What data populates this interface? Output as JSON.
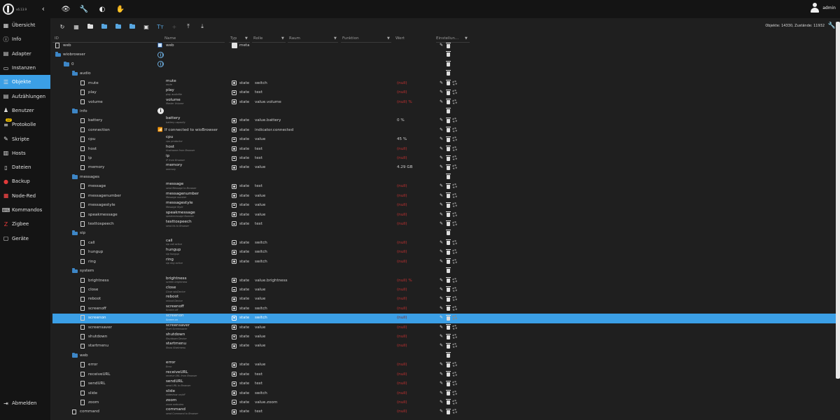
{
  "app": {
    "version": "v6.13.9",
    "user": "admin"
  },
  "sidebar": {
    "items": [
      {
        "label": "Übersicht",
        "icon": "grid-icon"
      },
      {
        "label": "Info",
        "icon": "info-icon"
      },
      {
        "label": "Adapter",
        "icon": "store-icon"
      },
      {
        "label": "Instanzen",
        "icon": "instances-icon"
      },
      {
        "label": "Objekte",
        "icon": "list-icon",
        "active": true
      },
      {
        "label": "Aufzählungen",
        "icon": "enums-icon"
      },
      {
        "label": "Benutzer",
        "icon": "user-icon"
      },
      {
        "label": "Protokolle",
        "icon": "log-icon",
        "badge": "17"
      },
      {
        "label": "Skripte",
        "icon": "scripts-icon"
      },
      {
        "label": "Hosts",
        "icon": "hosts-icon"
      },
      {
        "label": "Dateien",
        "icon": "files-icon"
      },
      {
        "label": "Backup",
        "icon": "backup-icon"
      },
      {
        "label": "Node-Red",
        "icon": "node-red-icon"
      },
      {
        "label": "Kommandos",
        "icon": "commands-icon"
      },
      {
        "label": "Zigbee",
        "icon": "zigbee-icon"
      },
      {
        "label": "Geräte",
        "icon": "devices-icon"
      }
    ],
    "logout_label": "Abmelden"
  },
  "toolbar": {
    "counts_text": "Objekte: 14330, Zustände: 11932"
  },
  "table": {
    "headers": {
      "id": "ID",
      "name": "Name",
      "type": "Typ",
      "role": "Rolle",
      "room": "Raum",
      "function": "Funktion",
      "value": "Wert",
      "settings": "Einstellun..."
    },
    "rows": [
      {
        "indent": 0,
        "kind": "file",
        "id": "web",
        "name": "web",
        "nameIcon": "web",
        "type": "meta",
        "typeIcon": "meta"
      },
      {
        "indent": 0,
        "kind": "folder",
        "id": "wiobrowser",
        "nameIcon": "globe"
      },
      {
        "indent": 1,
        "kind": "folder",
        "id": "0",
        "nameIcon": "globe"
      },
      {
        "indent": 2,
        "kind": "folder",
        "id": "audio"
      },
      {
        "indent": 3,
        "kind": "file",
        "id": "mute",
        "name": "mute",
        "sub": "mute",
        "type": "state",
        "role": "switch",
        "value": "(null)"
      },
      {
        "indent": 3,
        "kind": "file",
        "id": "play",
        "name": "play",
        "sub": "play audiofile",
        "type": "state",
        "role": "text",
        "value": "(null)"
      },
      {
        "indent": 3,
        "kind": "file",
        "id": "volume",
        "name": "volume",
        "sub": "Master Volume",
        "type": "state",
        "role": "value.volume",
        "value": "(null) %"
      },
      {
        "indent": 2,
        "kind": "folder",
        "id": "info",
        "nameIcon": "info"
      },
      {
        "indent": 3,
        "kind": "file",
        "id": "battery",
        "name": "battery",
        "sub": "battery capacity",
        "type": "state",
        "role": "value.battery",
        "value": "0 %",
        "valueOk": true
      },
      {
        "indent": 3,
        "kind": "file",
        "id": "connection",
        "name": "If connected to wioBrowser",
        "nameIcon": "wifi",
        "type": "state",
        "role": "indicator.connected"
      },
      {
        "indent": 3,
        "kind": "file",
        "id": "cpu",
        "name": "cpu",
        "sub": "cpu productor",
        "type": "state",
        "role": "value",
        "value": "45 %",
        "valueOk": true
      },
      {
        "indent": 3,
        "kind": "file",
        "id": "host",
        "name": "host",
        "sub": "Hostname from Browser",
        "type": "state",
        "role": "text",
        "value": "(null)"
      },
      {
        "indent": 3,
        "kind": "file",
        "id": "ip",
        "name": "ip",
        "sub": "IP from Browser",
        "type": "state",
        "role": "text",
        "value": "(null)"
      },
      {
        "indent": 3,
        "kind": "file",
        "id": "memory",
        "name": "memory",
        "sub": "memory",
        "type": "state",
        "role": "value",
        "value": "4.29 GB",
        "valueOk": true
      },
      {
        "indent": 2,
        "kind": "folder",
        "id": "messages"
      },
      {
        "indent": 3,
        "kind": "file",
        "id": "message",
        "name": "message",
        "sub": "send Message to Browser",
        "type": "state",
        "role": "text",
        "value": "(null)"
      },
      {
        "indent": 3,
        "kind": "file",
        "id": "messagenumber",
        "name": "messagenumber",
        "sub": "Message number",
        "type": "state",
        "role": "value",
        "value": "(null)"
      },
      {
        "indent": 3,
        "kind": "file",
        "id": "messagestyle",
        "name": "messagestyle",
        "sub": "Message Style",
        "type": "state",
        "role": "value",
        "value": "(null)"
      },
      {
        "indent": 3,
        "kind": "file",
        "id": "speakmessage",
        "name": "speakmessage",
        "sub": "speakmessage Number",
        "type": "state",
        "role": "value",
        "value": "(null)"
      },
      {
        "indent": 3,
        "kind": "file",
        "id": "texttospeech",
        "name": "texttospeech",
        "sub": "send tts to Browser",
        "type": "state",
        "role": "text",
        "value": "(null)"
      },
      {
        "indent": 2,
        "kind": "folder",
        "id": "sip"
      },
      {
        "indent": 3,
        "kind": "file",
        "id": "call",
        "name": "call",
        "sub": "sip call active",
        "type": "state",
        "role": "switch",
        "value": "(null)"
      },
      {
        "indent": 3,
        "kind": "file",
        "id": "hungup",
        "name": "hungup",
        "sub": "sip hungup",
        "type": "state",
        "role": "switch",
        "value": "(null)"
      },
      {
        "indent": 3,
        "kind": "file",
        "id": "ring",
        "name": "ring",
        "sub": "sip ring active",
        "type": "state",
        "role": "switch",
        "value": "(null)"
      },
      {
        "indent": 2,
        "kind": "folder",
        "id": "system"
      },
      {
        "indent": 3,
        "kind": "file",
        "id": "brightness",
        "name": "brightness",
        "sub": "screen brightness",
        "type": "state",
        "role": "value.brightness",
        "value": "(null) %"
      },
      {
        "indent": 3,
        "kind": "file",
        "id": "close",
        "name": "close",
        "sub": "Close wioDevice",
        "type": "state",
        "role": "value",
        "value": "(null)"
      },
      {
        "indent": 3,
        "kind": "file",
        "id": "reboot",
        "name": "reboot",
        "sub": "reboot Device",
        "type": "state",
        "role": "value",
        "value": "(null)"
      },
      {
        "indent": 3,
        "kind": "file",
        "id": "screenoff",
        "name": "screenoff",
        "sub": "Screen off",
        "type": "state",
        "role": "switch",
        "value": "(null)"
      },
      {
        "indent": 3,
        "kind": "file",
        "id": "screenon",
        "name": "screenon",
        "sub": "Screen on",
        "type": "state",
        "role": "switch",
        "value": "(null)",
        "selected": true
      },
      {
        "indent": 3,
        "kind": "file",
        "id": "screensaver",
        "name": "screensaver",
        "sub": "Start Screensaver",
        "type": "state",
        "role": "value",
        "value": "(null)"
      },
      {
        "indent": 3,
        "kind": "file",
        "id": "shutdown",
        "name": "shutdown",
        "sub": "Shutdown Device",
        "type": "state",
        "role": "value",
        "value": "(null)"
      },
      {
        "indent": 3,
        "kind": "file",
        "id": "startmenu",
        "name": "startmenu",
        "sub": "Show Startmenu",
        "type": "state",
        "role": "value",
        "value": "(null)"
      },
      {
        "indent": 2,
        "kind": "folder",
        "id": "web"
      },
      {
        "indent": 3,
        "kind": "file",
        "id": "error",
        "name": "error",
        "sub": "Error",
        "type": "state",
        "role": "value",
        "value": "(null)"
      },
      {
        "indent": 3,
        "kind": "file",
        "id": "receiveURL",
        "name": "receiveURL",
        "sub": "receive URL from Browser",
        "type": "state",
        "role": "text",
        "value": "(null)"
      },
      {
        "indent": 3,
        "kind": "file",
        "id": "sendURL",
        "name": "sendURL",
        "sub": "send URL to Browser",
        "type": "state",
        "role": "text",
        "value": "(null)"
      },
      {
        "indent": 3,
        "kind": "file",
        "id": "slide",
        "name": "slide",
        "sub": "slideshow on/off",
        "type": "state",
        "role": "switch",
        "value": "(null)"
      },
      {
        "indent": 3,
        "kind": "file",
        "id": "zoom",
        "name": "zoom",
        "sub": "zoom webview",
        "type": "state",
        "role": "value.zoom",
        "value": "(null)"
      },
      {
        "indent": 2,
        "kind": "file",
        "id": "command",
        "name": "command",
        "sub": "send Command to Browser",
        "type": "state",
        "role": "text",
        "value": "(null)"
      }
    ]
  }
}
